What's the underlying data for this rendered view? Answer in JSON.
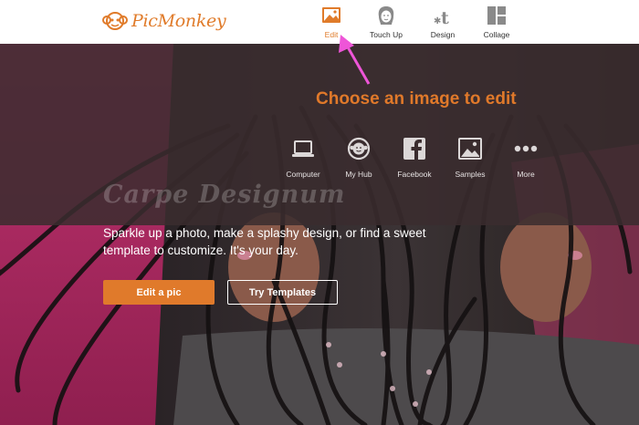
{
  "brand": {
    "name": "PicMonkey",
    "accent": "#e07b2a"
  },
  "nav": {
    "items": [
      {
        "label": "Edit",
        "icon": "photo-icon",
        "active": true
      },
      {
        "label": "Touch Up",
        "icon": "face-icon",
        "active": false
      },
      {
        "label": "Design",
        "icon": "design-icon",
        "active": false
      },
      {
        "label": "Collage",
        "icon": "collage-icon",
        "active": false
      }
    ]
  },
  "callout": {
    "text": "Choose an image to edit",
    "color": "#e0792a"
  },
  "sources": [
    {
      "label": "Computer",
      "icon": "laptop-icon"
    },
    {
      "label": "My Hub",
      "icon": "hub-icon"
    },
    {
      "label": "Facebook",
      "icon": "facebook-icon"
    },
    {
      "label": "Samples",
      "icon": "samples-icon"
    },
    {
      "label": "More",
      "icon": "more-icon"
    }
  ],
  "hero": {
    "tagline": "Carpe Designum",
    "subtext": "Sparkle up a photo, make a splashy design, or find a sweet template to customize. It's your day.",
    "primary_button": "Edit a pic",
    "secondary_button": "Try Templates"
  }
}
